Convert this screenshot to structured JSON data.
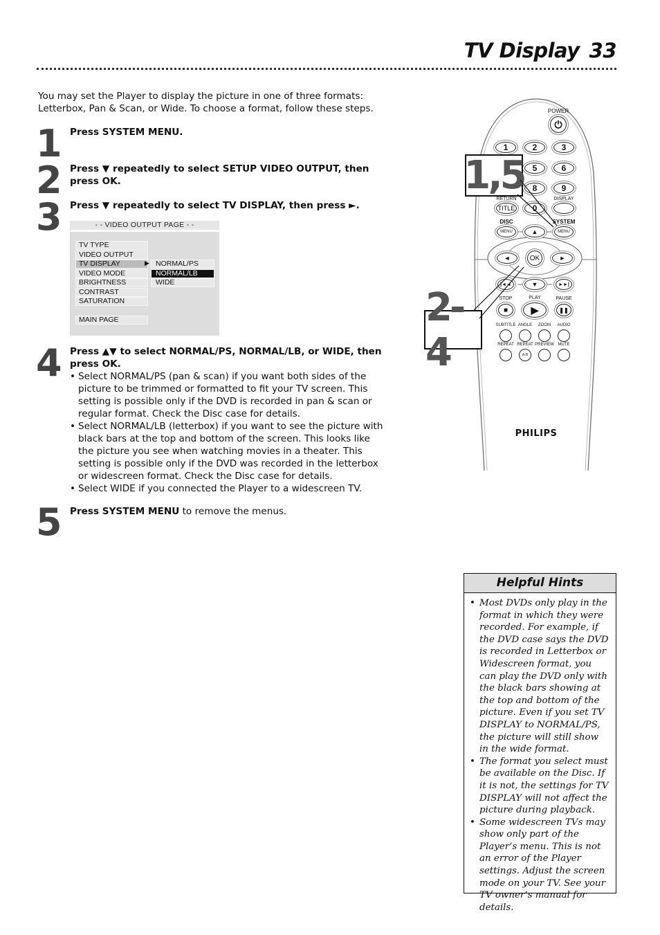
{
  "header": {
    "title": "TV Display",
    "page_number": "33"
  },
  "intro": "You may set the Player to display the picture in one of three formats: Letterbox, Pan & Scan, or Wide. To choose a format, follow these steps.",
  "steps": [
    {
      "number": "1",
      "html": "<b>Press SYSTEM MENU.</b>"
    },
    {
      "number": "2",
      "html": "<b>Press ▼ repeatedly to select SETUP VIDEO OUTPUT, then press OK.</b>"
    },
    {
      "number": "3",
      "html": "<b>Press ▼ repeatedly to select TV DISPLAY, then press ►.</b>"
    },
    {
      "number": "4",
      "html": "<b>Press ▲▼ to select NORMAL/PS, NORMAL/LB, or WIDE, then press OK.</b>",
      "bullets": [
        "Select NORMAL/PS (pan & scan) if you want both sides of the picture to be trimmed or formatted to fit your TV screen. This setting is possible only if the DVD is recorded in pan & scan or regular format. Check the Disc case for details.",
        "Select NORMAL/LB (letterbox) if you want to see the picture with black bars at the top and bottom of the screen. This looks like the picture you see when watching movies in a theater. This setting is possible only if the DVD was recorded in the letterbox or widescreen format. Check the Disc case for details.",
        "Select WIDE if you connected the Player to a widescreen TV."
      ]
    },
    {
      "number": "5",
      "html": "<b>Press SYSTEM MENU</b> to remove the menus."
    }
  ],
  "osd": {
    "title": "- -  VIDEO OUTPUT PAGE  - -",
    "items": [
      "TV TYPE",
      "VIDEO OUTPUT",
      "TV DISPLAY",
      "VIDEO MODE",
      "BRIGHTNESS",
      "CONTRAST",
      "SATURATION",
      "MAIN PAGE"
    ],
    "selected_item": "TV DISPLAY",
    "arrow": "▶",
    "sub_items": [
      "NORMAL/PS",
      "NORMAL/LB",
      "WIDE"
    ],
    "highlighted_sub_item": "NORMAL/LB"
  },
  "remote": {
    "brand": "PHILIPS",
    "labels": {
      "power": "POWER",
      "return": "RETURN",
      "display": "DISPLAY",
      "disc": "DISC",
      "system": "SYSTEM",
      "stop": "STOP",
      "play": "PLAY",
      "pause": "PAUSE",
      "subtitle": "SUBTITLE",
      "angle": "ANGLE",
      "zoom": "ZOOM",
      "audio": "AUDIO",
      "repeat": "REPEAT",
      "repeat_ab": "REPEAT",
      "preview": "PREVIEW",
      "mute": "MUTE"
    },
    "buttons": {
      "n1": "1",
      "n2": "2",
      "n3": "3",
      "n5": "5",
      "n6": "6",
      "n8": "8",
      "n9": "9",
      "title": "TITLE",
      "n0": "0",
      "disc_menu": "MENU",
      "up": "▲",
      "system_menu": "MENU",
      "left": "◄",
      "ok": "OK",
      "right": "►",
      "prev": "|◄◄",
      "down": "▼",
      "next": "►►|",
      "stop": "■",
      "play": "▶",
      "pause": "❚❚",
      "ab": "A-B",
      "power": "⏻"
    },
    "callouts": [
      "1,5",
      "2-4"
    ]
  },
  "hints": {
    "title": "Helpful Hints",
    "items": [
      "Most DVDs only play in the format in which they were recorded. For example, if the DVD case says the DVD is recorded in Letterbox or Widescreen format, you can play the DVD only with the black bars showing at the top and bottom of the picture. Even if you set TV DISPLAY to NORMAL/PS, the picture will still show in the wide format.",
      "The format you select must be available on the Disc. If it is not, the settings for TV DISPLAY will not affect the picture during playback.",
      "Some widescreen TVs may show only part of the Player’s menu. This is not an error of the Player settings. Adjust the screen mode on your TV. See your TV owner’s manual for details."
    ]
  }
}
